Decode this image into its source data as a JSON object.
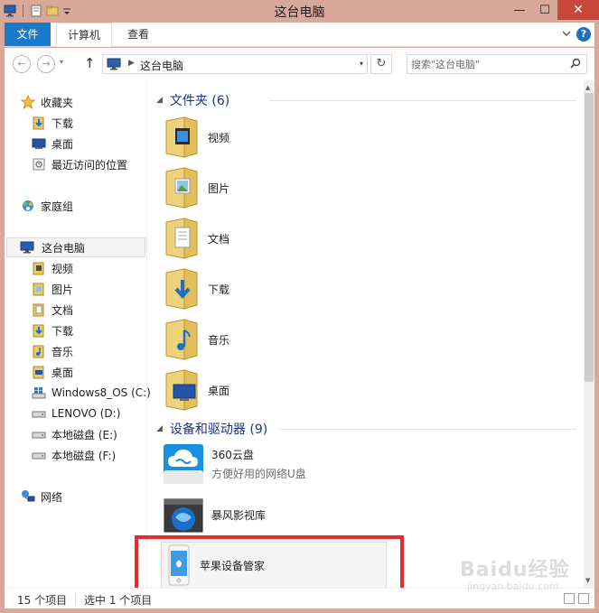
{
  "window": {
    "title": "这台电脑",
    "minimize": "—",
    "maximize": "☐",
    "close": "✕"
  },
  "ribbon": {
    "tabs": [
      "文件",
      "计算机",
      "查看"
    ],
    "expand_icon": "chevron-down-icon",
    "help": "?"
  },
  "nav": {
    "back": "←",
    "forward": "→",
    "recent": "▾",
    "up": "↑",
    "address": "这台电脑",
    "address_dropdown": "▾",
    "refresh": "↻",
    "search_placeholder": "搜索\"这台电脑\""
  },
  "sidebar": {
    "favorites": {
      "label": "收藏夹",
      "items": [
        "下载",
        "桌面",
        "最近访问的位置"
      ]
    },
    "homegroup": "家庭组",
    "thispc": {
      "label": "这台电脑",
      "items": [
        "视频",
        "图片",
        "文档",
        "下载",
        "音乐",
        "桌面",
        "Windows8_OS (C:)",
        "LENOVO (D:)",
        "本地磁盘 (E:)",
        "本地磁盘 (F:)"
      ]
    },
    "network": "网络"
  },
  "content": {
    "folders_header": "文件夹 (6)",
    "folders": [
      "视频",
      "图片",
      "文档",
      "下载",
      "音乐",
      "桌面"
    ],
    "devices_header": "设备和驱动器 (9)",
    "devices": [
      {
        "name": "360云盘",
        "sub": "方便好用的网络U盘"
      },
      {
        "name": "暴风影视库",
        "sub": ""
      },
      {
        "name": "苹果设备管家",
        "sub": ""
      }
    ]
  },
  "status": {
    "count": "15 个项目",
    "selected": "选中 1 个项目"
  },
  "watermark": {
    "text": "Baidu经验",
    "sub": "jingyan.baidu.com"
  },
  "colors": {
    "accent": "#1979ca",
    "frame": "#d8a99b",
    "close": "#c7483a",
    "annotation": "#e52d2d",
    "header_text": "#1e3287"
  }
}
